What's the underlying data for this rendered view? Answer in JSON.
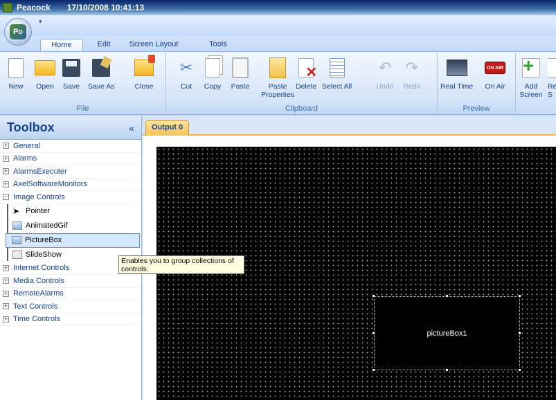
{
  "window": {
    "app_name": "Peacock",
    "timestamp": "17/10/2008 10:41:13"
  },
  "app_button_label": "Po",
  "quick_access_arrow": "▾",
  "tabs": [
    {
      "label": "Home",
      "active": true
    },
    {
      "label": "Edit",
      "active": false
    },
    {
      "label": "Screen Layout",
      "active": false
    },
    {
      "label": "Tools",
      "active": false
    }
  ],
  "ribbon": {
    "groups": {
      "file": "File",
      "clipboard": "Clipboard",
      "preview": "Preview"
    },
    "buttons": {
      "new": "New",
      "open": "Open",
      "save": "Save",
      "save_as": "Save As",
      "close": "Close",
      "cut": "Cut",
      "copy": "Copy",
      "paste": "Paste",
      "paste_properties": "Paste Properties",
      "delete": "Delete",
      "select_all": "Select All",
      "undo": "Undo",
      "redo": "Redo",
      "real_time": "Real Time",
      "on_air": "On Air",
      "add_screen": "Add Screen",
      "partial_label": "Re S"
    },
    "on_air_badge": "ON AIR"
  },
  "toolbox": {
    "title": "Toolbox",
    "collapse_glyph": "«",
    "categories_before": [
      "General",
      "Alarms",
      "AlarmsExecuter",
      "AxelSoftwareMonitors"
    ],
    "expanded_category": "Image Controls",
    "items": [
      "Pointer",
      "AnimatedGif",
      "PictureBox",
      "SlideShow"
    ],
    "selected_item": "PictureBox",
    "categories_after": [
      "Internet Controls",
      "Media Controls",
      "RemoteAlarms",
      "Text Controls",
      "Time Controls"
    ],
    "expand_glyph": "+",
    "collapse_node_glyph": "−"
  },
  "tooltip": "Enables you to group collections of controls.",
  "document": {
    "tab": "Output 0",
    "picture_box_label": "pictureBox1"
  }
}
